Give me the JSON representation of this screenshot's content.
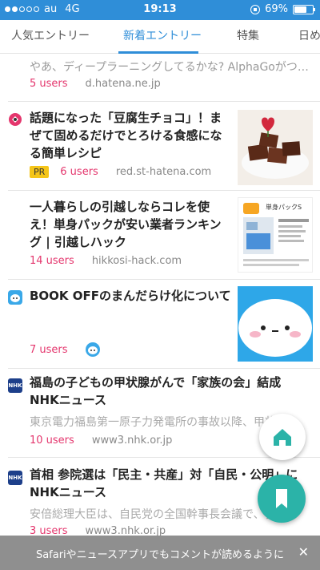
{
  "status_bar": {
    "carrier": "au",
    "network": "4G",
    "time": "19:13",
    "battery": "69%",
    "signal_bars": 2
  },
  "tabs": [
    {
      "label": "人気エントリー",
      "active": false
    },
    {
      "label": "新着エントリー",
      "active": true
    },
    {
      "label": "特集",
      "active": false
    },
    {
      "label": "日め",
      "active": false
    }
  ],
  "entries": [
    {
      "title": "",
      "excerpt": "やあ、ディープラーニングしてるかな? AlphaGoがつ…",
      "users": "5 users",
      "domain": "d.hatena.ne.jp"
    },
    {
      "title": "話題になった「豆腐生チョコ」！ま\nぜて固めるだけでとろける食感にな\nる簡単レシピ",
      "badge": "PR",
      "users": "6 users",
      "domain": "red.st-hatena.com",
      "thumb": "chocolate-photo"
    },
    {
      "title": "一人暮らしの引越しならコレを使\nえ！単身パックが安い業者ランキン\nグ | 引越しハック",
      "users": "14 users",
      "domain": "hikkosi-hack.com",
      "thumb": "moving-pack-illustration",
      "thumb_text": "単身パックS"
    },
    {
      "title": "BOOK OFFのまんだらけ化について",
      "users": "7 users",
      "thumb": "face-illustration"
    },
    {
      "title": "福島の子どもの甲状腺がんで「家族の会」結成\nNHKニュース",
      "excerpt": "東京電力福島第一原子力発電所の事故以降、甲状",
      "users": "10 users",
      "domain": "www3.nhk.or.jp",
      "favicon": "NHK"
    },
    {
      "title": "首相 参院選は「民主・共産」対「自民・公明」に\nNHKニュース",
      "excerpt": "安倍総理大臣は、自民党の全国幹事長会議で、参",
      "users": "3 users",
      "domain": "www3.nhk.or.jp",
      "favicon": "NHK"
    }
  ],
  "banner": {
    "text": "Safariやニュースアプリでもコメントが読めるように",
    "close": "✕"
  },
  "colors": {
    "accent": "#2f8ed8",
    "users": "#e4366d",
    "fab_bookmark": "#2bb3a8",
    "pr_badge": "#f5c518"
  }
}
